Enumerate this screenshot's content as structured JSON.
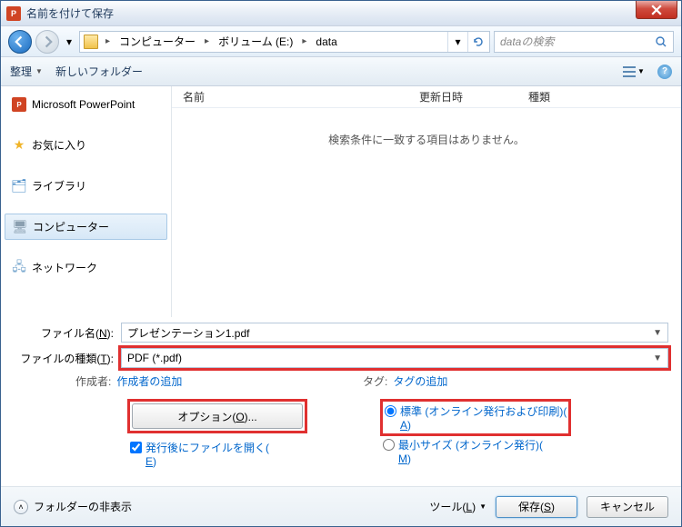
{
  "title": "名前を付けて保存",
  "breadcrumb": {
    "seg1": "コンピューター",
    "seg2": "ボリューム (E:)",
    "seg3": "data"
  },
  "search": {
    "placeholder": "dataの検索"
  },
  "toolbar": {
    "organize": "整理",
    "newfolder": "新しいフォルダー"
  },
  "sidebar": {
    "app": "Microsoft PowerPoint",
    "fav": "お気に入り",
    "lib": "ライブラリ",
    "comp": "コンピューター",
    "net": "ネットワーク"
  },
  "columns": {
    "name": "名前",
    "date": "更新日時",
    "type": "種類"
  },
  "empty_msg": "検索条件に一致する項目はありません。",
  "form": {
    "filename_label": "ファイル名(",
    "filename_u": "N",
    "filename_label2": "):",
    "filename_value": "プレゼンテーション1.pdf",
    "filetype_label": "ファイルの種類(",
    "filetype_u": "T",
    "filetype_label2": "):",
    "filetype_value": "PDF (*.pdf)"
  },
  "meta": {
    "author_label": "作成者:",
    "author_link": "作成者の追加",
    "tag_label": "タグ:",
    "tag_link": "タグの追加"
  },
  "options": {
    "button": "オプション(",
    "button_u": "O",
    "button_suffix": ")...",
    "open_after": "発行後にファイルを開く(",
    "open_after_u": "E",
    "open_after_suffix": ")",
    "standard": "標準 (オンライン発行および印刷)(",
    "standard_u": "A",
    "standard_suffix": ")",
    "minsize": "最小サイズ (オンライン発行)(",
    "minsize_u": "M",
    "minsize_suffix": ")"
  },
  "footer": {
    "hide": "フォルダーの非表示",
    "tools": "ツール(",
    "tools_u": "L",
    "tools_suffix": ")",
    "save": "保存(",
    "save_u": "S",
    "save_suffix": ")",
    "cancel": "キャンセル"
  }
}
